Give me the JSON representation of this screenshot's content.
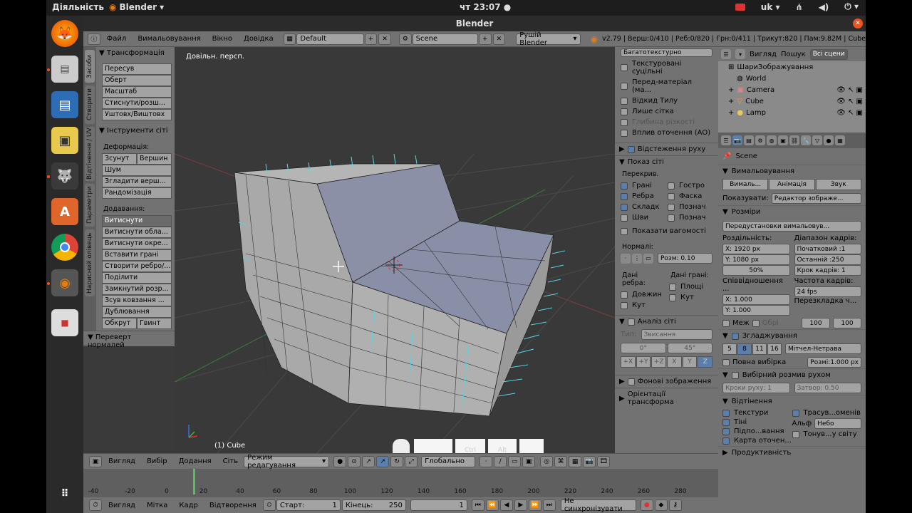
{
  "topbar": {
    "activities": "Діяльність",
    "app_name": "Blender",
    "clock": "чт 23:07",
    "lang": "uk"
  },
  "window": {
    "title": "Blender"
  },
  "infobar": {
    "menu": [
      "Файл",
      "Вимальовування",
      "Вікно",
      "Довідка"
    ],
    "layout": "Default",
    "scene": "Scene",
    "engine": "Рушій Blender",
    "stats": "v2.79 | Верш:0/410 | Реб:0/820 | Грн:0/411 | Трикут:820 | Пам:9.82M | Cube"
  },
  "tool_tabs": [
    "Засоби",
    "Створити",
    "Відтінення / UV",
    "Параметри",
    "Нарисний олівець"
  ],
  "toolshelf": {
    "transform_header": "Трансформація",
    "transform_buttons": [
      "Пересув",
      "Оберт",
      "Масштаб",
      "Стиснути/розш...",
      "Уштовх/Виштовх"
    ],
    "mesh_tools_header": "Інструменти сіті",
    "deform_label": "Деформація:",
    "deform_row": [
      "Зсунут",
      "Вершин"
    ],
    "deform_buttons": [
      "Шум",
      "Згладити верш...",
      "Рандомізація"
    ],
    "add_label": "Додавання:",
    "add_buttons": [
      "Витиснути",
      "Витиснути обла...",
      "Витиснути окре...",
      "Вставити грані",
      "Створити ребро/...",
      "Поділити",
      "Замкнутий розр...",
      "Зсув ковзання ...",
      "Дублювання"
    ],
    "add_row": [
      "Обкрут",
      "Гвинт"
    ],
    "flip_normals": "Переверт нормалей"
  },
  "viewport": {
    "view_label": "Довільн. персп.",
    "object_label": "(1) Cube",
    "keys": [
      "",
      "Ctrl",
      "Alt",
      ""
    ]
  },
  "npanel": {
    "top_field": "Багатотекстурно",
    "checks1": [
      {
        "label": "Текстуровані суцільні",
        "on": false
      },
      {
        "label": "Перед-матеріал (ма...",
        "on": false
      },
      {
        "label": "Відкид Тилу",
        "on": false
      },
      {
        "label": "Лише сітка",
        "on": false
      },
      {
        "label": "Глибина різкості",
        "on": false
      },
      {
        "label": "Вплив оточення (AO)",
        "on": false
      }
    ],
    "retopo": "Відстеження руху",
    "mesh_display": "Показ сіті",
    "overlays_label": "Перекрив.",
    "overlays_left": [
      {
        "label": "Грані",
        "on": true
      },
      {
        "label": "Ребра",
        "on": true
      },
      {
        "label": "Складк",
        "on": true
      },
      {
        "label": "Шви",
        "on": false
      }
    ],
    "overlays_right": [
      {
        "label": "Гостро",
        "on": false
      },
      {
        "label": "Фаска",
        "on": false
      },
      {
        "label": "Познач",
        "on": false
      },
      {
        "label": "Познач",
        "on": false
      }
    ],
    "show_weights": "Показати вагомості",
    "normals_label": "Нормалі:",
    "normals_size": "Розм: 0.10",
    "edge_data": "Дані ребра:",
    "face_data": "Дані грані:",
    "edge_items": [
      "Довжин",
      "Кут"
    ],
    "face_items": [
      "Площі",
      "Кут"
    ],
    "mesh_analysis": "Аналіз сіті",
    "type_label": "Тип:",
    "type_value": "Звисання",
    "angle_min": "0°",
    "angle_max": "45°",
    "axes": [
      "+X",
      "+Y",
      "+Z",
      "X",
      "Y",
      "Z"
    ],
    "bg_images": "Фонові зображення",
    "transform_orient": "Орієнтації трансформа"
  },
  "outliner": {
    "menu": [
      "Вигляд",
      "Пошук"
    ],
    "filter": "Всі сцени",
    "rows": [
      "ШариЗображування",
      "World",
      "Camera",
      "Cube",
      "Lamp"
    ]
  },
  "properties": {
    "scene_name": "Scene",
    "render_header": "Вимальовування",
    "render_buttons": [
      "Вималь...",
      "Анімація",
      "Звук"
    ],
    "display_label": "Показувати:",
    "display_value": "Редактор зображе...",
    "dimensions_header": "Розміри",
    "preset": "Передустановки вимальовув...",
    "resolution_label": "Роздільність:",
    "res_x": "1920 px",
    "res_y": "1080 px",
    "res_pct": "50%",
    "frame_range_label": "Діапазон кадрів:",
    "frame_start": "Початковий :1",
    "frame_end": "Останній :250",
    "frame_step": "Крок кадрів: 1",
    "aspect_label": "Співвідношення ...",
    "aspect_x": "1.000",
    "aspect_y": "1.000",
    "fps_label": "Частота кадрів:",
    "fps": "24 fps",
    "remap_label": "Перезкладка ч...",
    "remap_old": "100",
    "remap_new": "100",
    "border": "Меж",
    "crop": "Обрі",
    "aa_header": "Згладжування",
    "aa_samples": [
      "5",
      "8",
      "11",
      "16"
    ],
    "aa_filter": "Мітчел-Нетрава",
    "full_sample": "Повна вибірка",
    "filter_size": "Розмі:1.000 px",
    "motion_blur": "Вибірний розмив рухом",
    "mb_steps": "Кроки руху: 1",
    "mb_shutter": "Затвор: 0.50",
    "shading_header": "Відтінення",
    "shading_items": [
      "Текстури",
      "Тіні",
      "Підпо...вання",
      "Карта оточен..."
    ],
    "raytrace": "Трасув...оменів",
    "alpha_label": "Альф",
    "alpha_value": "Небо",
    "world_tone": "Тонув...у світу",
    "performance": "Продуктивність"
  },
  "view3d_header": {
    "menu": [
      "Вигляд",
      "Вибір",
      "Додання",
      "Сіть"
    ],
    "mode": "Режим редагування",
    "orientation": "Глобально"
  },
  "timeline": {
    "ticks": [
      "-40",
      "-20",
      "0",
      "20",
      "40",
      "60",
      "80",
      "100",
      "120",
      "140",
      "160",
      "180",
      "200",
      "220",
      "240",
      "260",
      "280"
    ],
    "current_frame": 0,
    "menu": [
      "Вигляд",
      "Мітка",
      "Кадр",
      "Відтворення"
    ],
    "start": "Старт:",
    "start_val": "1",
    "end": "Кінець:",
    "end_val": "250",
    "current": "1",
    "sync": "Не синхронізувати"
  },
  "colors": {
    "panel": "#727272",
    "viewport_bg": "#393939",
    "mesh_face": "#b0b0b0",
    "selected_face": "#8a8fa8",
    "normal_line": "#55d5e0",
    "accent": "#e95420"
  }
}
